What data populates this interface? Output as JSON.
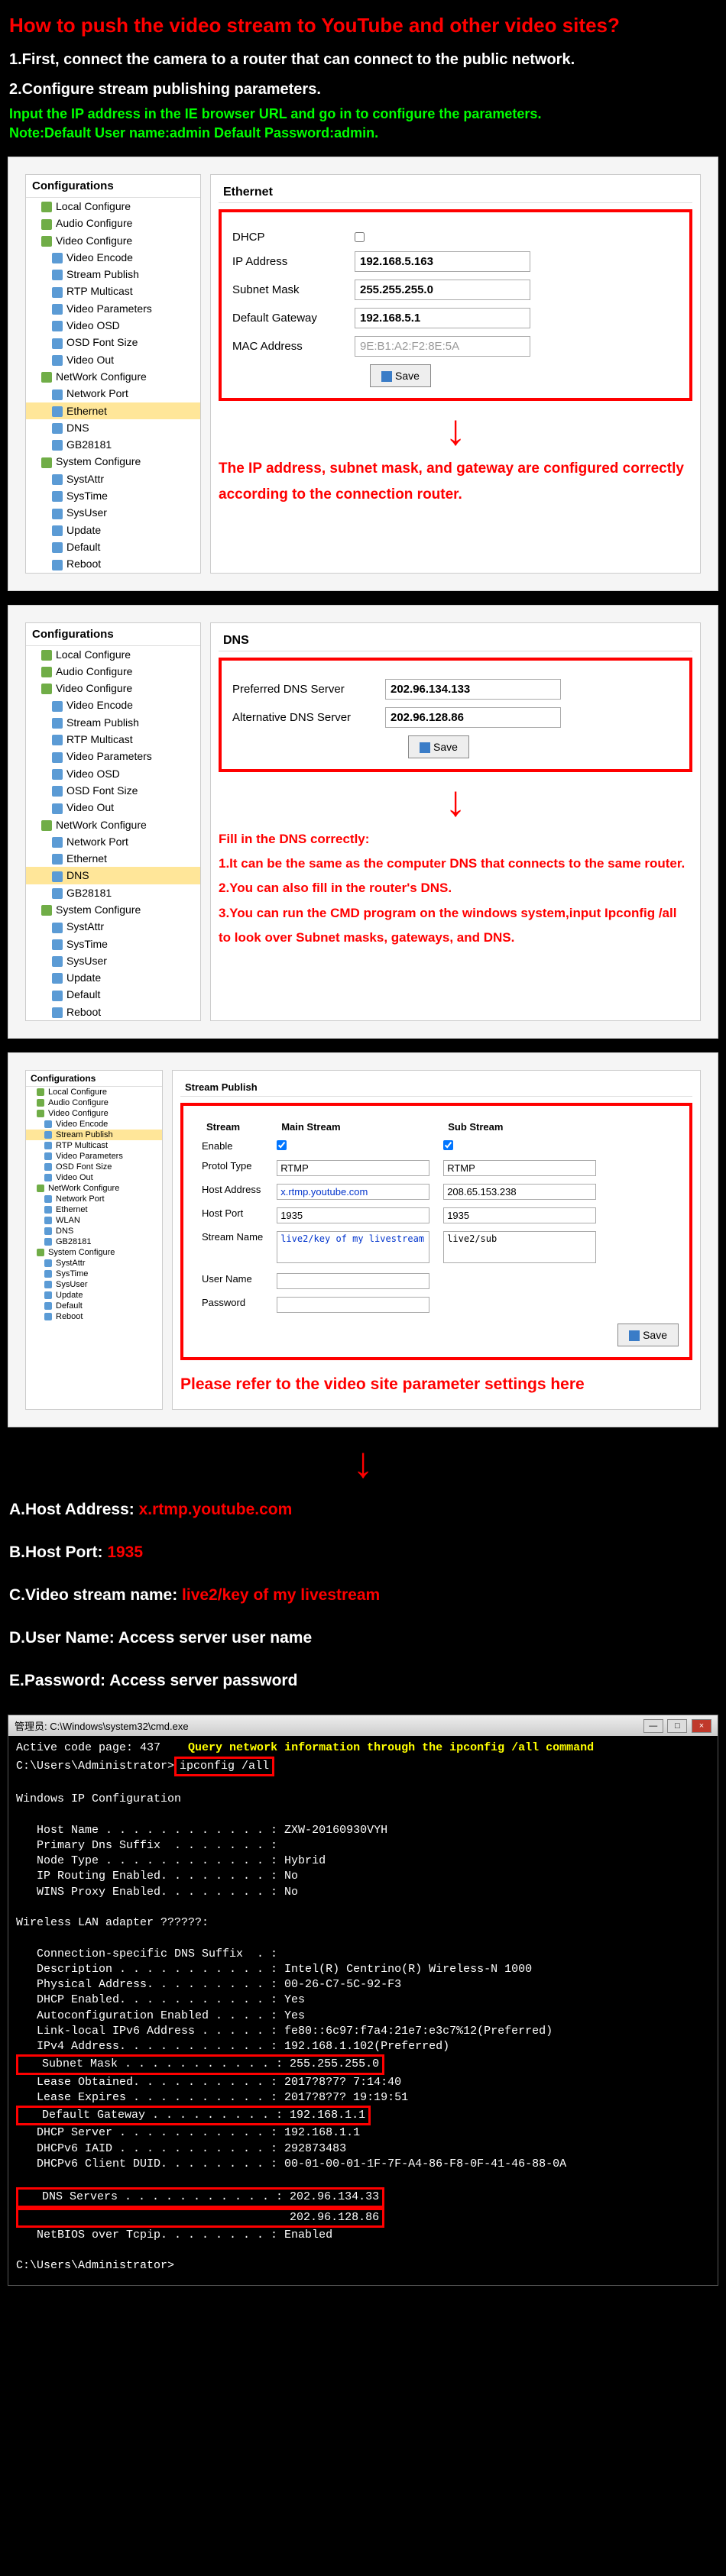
{
  "header": "How to push the video stream to YouTube and other video sites?",
  "step1": "1.First, connect the camera to a router that can connect to the public network.",
  "step2": "2.Configure stream publishing parameters.",
  "instruct1": "Input  the IP address in the IE browser URL and go in to configure the parameters.",
  "instruct2": "Note:Default User name:admin  Default Password:admin.",
  "tree_title": "Configurations",
  "tree": {
    "local": "Local Configure",
    "audio": "Audio Configure",
    "video": "Video Configure",
    "venc": "Video Encode",
    "spub": "Stream Publish",
    "rtpm": "RTP Multicast",
    "vparam": "Video Parameters",
    "vosd": "Video OSD",
    "osdf": "OSD Font Size",
    "vout": "Video Out",
    "net": "NetWork Configure",
    "nport": "Network Port",
    "eth": "Ethernet",
    "dns": "DNS",
    "gb": "GB28181",
    "wlan": "WLAN",
    "sys": "System Configure",
    "sattr": "SystAttr",
    "stime": "SysTime",
    "suser": "SysUser",
    "upd": "Update",
    "def": "Default",
    "reb": "Reboot"
  },
  "eth": {
    "title": "Ethernet",
    "dhcp": "DHCP",
    "ip_l": "IP Address",
    "ip_v": "192.168.5.163",
    "sm_l": "Subnet Mask",
    "sm_v": "255.255.255.0",
    "gw_l": "Default Gateway",
    "gw_v": "192.168.5.1",
    "mac_l": "MAC Address",
    "mac_v": "9E:B1:A2:F2:8E:5A",
    "save": "Save",
    "note": "The IP address, subnet mask, and gateway are configured correctly according to the connection router."
  },
  "dns": {
    "title": "DNS",
    "p_l": "Preferred DNS Server",
    "p_v": "202.96.134.133",
    "a_l": "Alternative DNS Server",
    "a_v": "202.96.128.86",
    "save": "Save",
    "h": "Fill in the DNS correctly:",
    "n1": "1.It can be the same as the computer DNS that connects to the same router.",
    "n2": "2.You can also fill in the router's DNS.",
    "n3": "3.You can run the CMD program on the windows system,input Ipconfig /all to look over Subnet masks, gateways, and DNS."
  },
  "sp": {
    "title": "Stream Publish",
    "h_stream": "Stream",
    "h_main": "Main Stream",
    "h_sub": "Sub Stream",
    "enable": "Enable",
    "ptype": "Protol Type",
    "ptype_v": "RTMP",
    "haddr": "Host Address",
    "haddr_m": "x.rtmp.youtube.com",
    "haddr_s": "208.65.153.238",
    "hport": "Host Port",
    "hport_m": "1935",
    "hport_s": "1935",
    "sname": "Stream Name",
    "sname_m": "live2/key of my livestream",
    "sname_s": "live2/sub",
    "uname": "User Name",
    "pwd": "Password",
    "save": "Save",
    "ref": "Please refer to the video site parameter settings here"
  },
  "params": {
    "a_l": "A.Host Address: ",
    "a_v": "x.rtmp.youtube.com",
    "b_l": "B.Host Port: ",
    "b_v": "1935",
    "c_l": "C.Video stream name: ",
    "c_v": "live2/key of my livestream",
    "d_l": "D.User Name: Access server user name",
    "e_l": "E.Password: Access server password"
  },
  "cmd": {
    "title": "管理员: C:\\Windows\\system32\\cmd.exe",
    "note": "Query network information through the ipconfig /all command",
    "acp": "Active code page: 437",
    "prompt1": "C:\\Users\\Administrator>",
    "cmd_in": "ipconfig /all",
    "wic": "Windows IP Configuration",
    "hn": "   Host Name . . . . . . . . . . . . : ZXW-20160930VYH",
    "pds": "   Primary Dns Suffix  . . . . . . . :",
    "nt": "   Node Type . . . . . . . . . . . . : Hybrid",
    "ire": "   IP Routing Enabled. . . . . . . . : No",
    "wpe": "   WINS Proxy Enabled. . . . . . . . : No",
    "wla": "Wireless LAN adapter ??????:",
    "csds": "   Connection-specific DNS Suffix  . :",
    "desc": "   Description . . . . . . . . . . . : Intel(R) Centrino(R) Wireless-N 1000",
    "pa": "   Physical Address. . . . . . . . . : 00-26-C7-5C-92-F3",
    "de": "   DHCP Enabled. . . . . . . . . . . : Yes",
    "ace": "   Autoconfiguration Enabled . . . . : Yes",
    "ll6": "   Link-local IPv6 Address . . . . . : fe80::6c97:f7a4:21e7:e3c7%12(Preferred)",
    "ip4": "   IPv4 Address. . . . . . . . . . . : 192.168.1.102(Preferred)",
    "sm": "   Subnet Mask . . . . . . . . . . . : 255.255.255.0",
    "lo": "   Lease Obtained. . . . . . . . . . : 2017?8?7? 7:14:40",
    "le": "   Lease Expires . . . . . . . . . . : 2017?8?7? 19:19:51",
    "dg": "   Default Gateway . . . . . . . . . : 192.168.1.1",
    "ds": "   DHCP Server . . . . . . . . . . . : 192.168.1.1",
    "d6i": "   DHCPv6 IAID . . . . . . . . . . . : 292873483",
    "d6c": "   DHCPv6 Client DUID. . . . . . . . : 00-01-00-01-1F-7F-A4-86-F8-0F-41-46-88-0A",
    "dns1": "   DNS Servers . . . . . . . . . . . : 202.96.134.33",
    "dns2": "                                       202.96.128.86",
    "nbt": "   NetBIOS over Tcpip. . . . . . . . : Enabled",
    "prompt2": "C:\\Users\\Administrator>"
  }
}
